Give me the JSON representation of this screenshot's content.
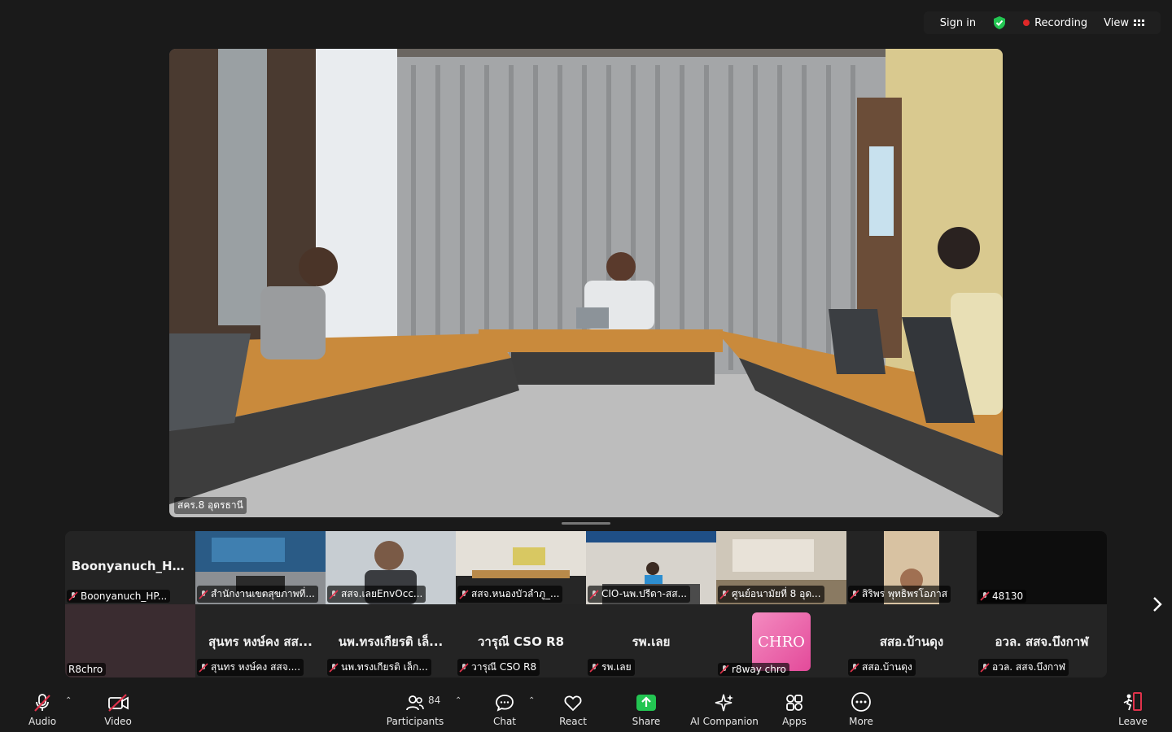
{
  "topbar": {
    "sign_in": "Sign in",
    "recording": "Recording",
    "view": "View"
  },
  "main_video": {
    "label": "สคร.8 อุดรธานี"
  },
  "gallery": [
    {
      "big": "Boonyanuch_HP...",
      "label": "Boonyanuch_HP..."
    },
    {
      "big": "",
      "label": "สำนักงานเขตสุขภาพที่..."
    },
    {
      "big": "",
      "label": "สสจ.เลยEnvOcc..."
    },
    {
      "big": "",
      "label": "สสจ.หนองบัวลำภู_..."
    },
    {
      "big": "",
      "label": "CIO-นพ.ปรีดา-สส..."
    },
    {
      "big": "",
      "label": "ศูนย์อนามัยที่ 8 อุด..."
    },
    {
      "big": "",
      "label": "สิริพร พุทธิพรโอภาส"
    },
    {
      "big": "",
      "label": "48130"
    },
    {
      "big": "",
      "label": "R8chro"
    },
    {
      "big": "สุนทร หงษ์คง สส...",
      "label": "สุนทร หงษ์คง สสจ...."
    },
    {
      "big": "นพ.ทรงเกียรติ  เล็...",
      "label": "นพ.ทรงเกียรติ  เล็ก..."
    },
    {
      "big": "วารุณี CSO R8",
      "label": "วารุณี CSO R8"
    },
    {
      "big": "รพ.เลย",
      "label": "รพ.เลย"
    },
    {
      "big": "CHRO",
      "label": "r8way chro"
    },
    {
      "big": "สสอ.บ้านดุง",
      "label": "สสอ.บ้านดุง"
    },
    {
      "big": "อวล. สสจ.บึงกาฬ",
      "label": "อวล. สสจ.บึงกาฬ"
    }
  ],
  "toolbar": {
    "audio": "Audio",
    "video": "Video",
    "participants": "Participants",
    "participants_count": "84",
    "chat": "Chat",
    "react": "React",
    "share": "Share",
    "ai_companion": "AI Companion",
    "apps": "Apps",
    "more": "More",
    "leave": "Leave"
  },
  "colors": {
    "accent_green": "#23c552",
    "mic_off_red": "#e0324b",
    "record_red": "#e02828"
  }
}
